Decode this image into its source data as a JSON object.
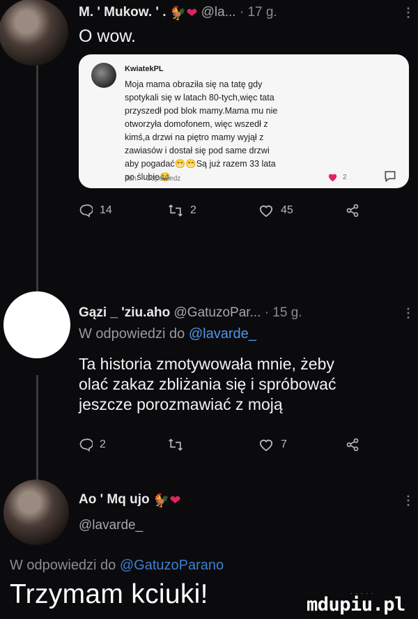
{
  "tweet1": {
    "name": "M. ' Mukow. ' .",
    "emoji": "🐓❤",
    "handle": "@la...",
    "time": "· 17 g.",
    "menu": "⋮",
    "text": "O wow.",
    "quote": {
      "name": "KwiatekPL",
      "lines": [
        "Moja mama obraziła się na tatę gdy",
        "spotykali się w latach 80-tych,więc tata",
        "przyszedł pod blok mamy.Mama mu nie",
        "otworzyła domofonem, więc wszedł z",
        "kimś,a drzwi na piętro mamy wyjął z",
        "zawiasów i dostał się pod same drzwi",
        "aby pogadać😁😁Są już razem 33 lata",
        "po ślubie😂"
      ],
      "meta_time": "2dn.",
      "meta_reply": "Odpowiedz",
      "likes": "2"
    },
    "replies": "14",
    "retweets": "2",
    "likes": "45"
  },
  "tweet2": {
    "name": "Gązi _ 'ziu.aho",
    "handle": "@GatuzoPar...",
    "time": "· 15 g.",
    "menu": "⋮",
    "reply_prefix": "W odpowiedzi do ",
    "reply_mention": "@lavarde_",
    "text_lines": [
      "Ta historia zmotywowała mnie, żeby",
      "olać zakaz zbliżania się i spróbować",
      "jeszcze porozmawiać z moją"
    ],
    "replies": "2",
    "retweets": "",
    "likes": "7"
  },
  "tweet3": {
    "name": "Ao ' Mq ujo",
    "emoji": "🐓❤",
    "menu": "⋮",
    "handle": "@lavarde_",
    "reply_prefix": "W odpowiedzi do ",
    "reply_mention": "@GatuzoParano",
    "text": "Trzymam kciuki!"
  },
  "watermark": {
    "text": "mdupiu.pl",
    "dots": "·  ·  ·  ·  ·"
  },
  "colors": {
    "background": "#0b0b0d",
    "mention": "#4f96e8",
    "heart": "#e0245e",
    "card": "#f6f6f7"
  }
}
